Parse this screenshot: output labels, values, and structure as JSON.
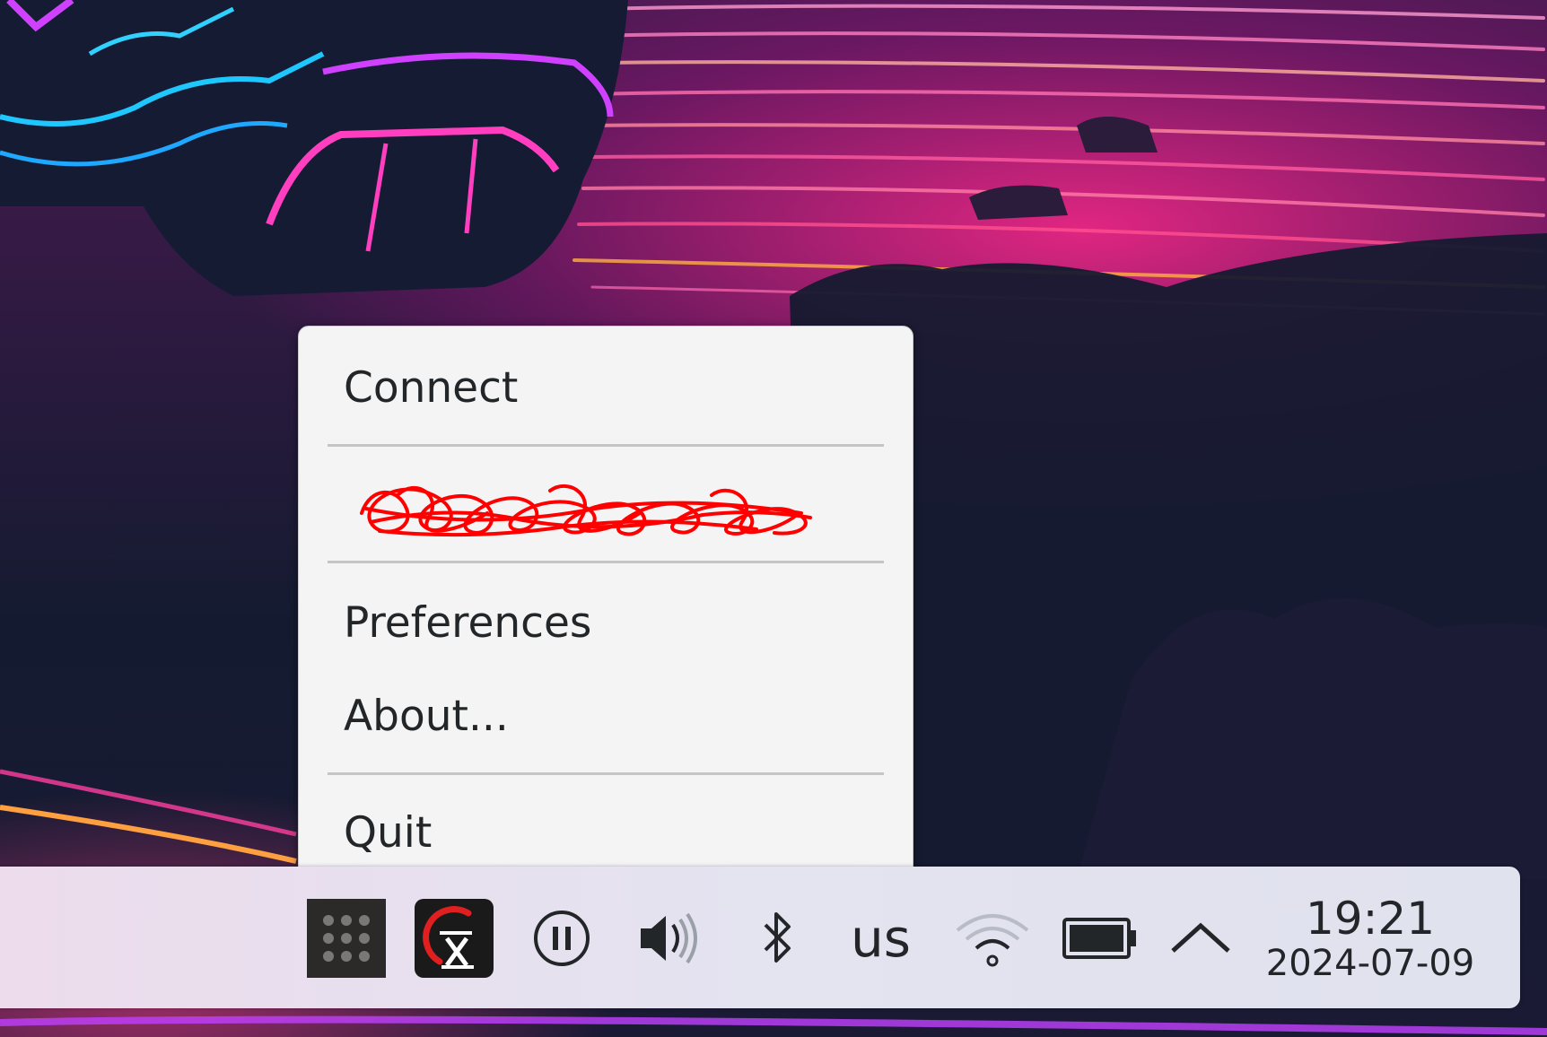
{
  "menu": {
    "items": [
      {
        "label": "Connect"
      },
      {
        "label": "Preferences"
      },
      {
        "label": "About..."
      },
      {
        "label": "Quit"
      }
    ],
    "redacted_item_note": ""
  },
  "panel": {
    "keyboard_layout": "us",
    "clock": {
      "time": "19:21",
      "date": "2024-07-09"
    },
    "icons": [
      "app-grid-icon",
      "expressvpn-icon",
      "media-pause-icon",
      "volume-icon",
      "bluetooth-icon",
      "wifi-icon",
      "battery-icon",
      "show-hidden-icons-arrow-icon"
    ]
  },
  "colors": {
    "menu_bg": "#f3f4f3",
    "menu_text": "#232629",
    "panel_bg": "#e4e3f0",
    "scribble": "#ff0000"
  }
}
